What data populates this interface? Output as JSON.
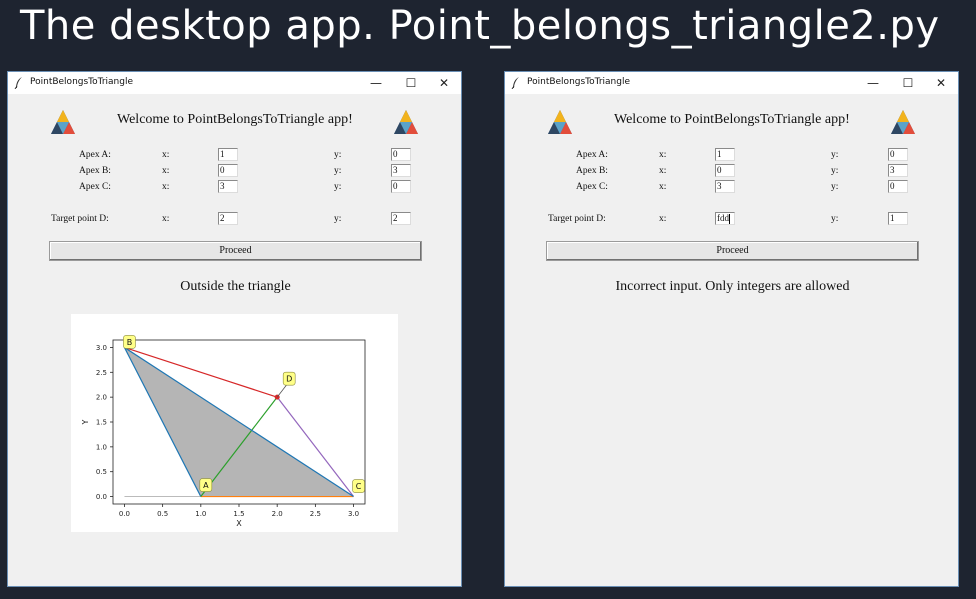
{
  "banner": "The desktop app. Point_belongs_triangle2.py",
  "windows": [
    {
      "title": "PointBelongsToTriangle",
      "controls": {
        "minimize": "—",
        "maximize": "☐",
        "close": "✕"
      },
      "welcome": "Welcome to PointBelongsToTriangle app!",
      "apexA": {
        "label": "Apex A:",
        "x_label": "x:",
        "x": "1",
        "y_label": "y:",
        "y": "0"
      },
      "apexB": {
        "label": "Apex B:",
        "x_label": "x:",
        "x": "0",
        "y_label": "y:",
        "y": "3"
      },
      "apexC": {
        "label": "Apex C:",
        "x_label": "x:",
        "x": "3",
        "y_label": "y:",
        "y": "0"
      },
      "target": {
        "label": "Target point D:",
        "x_label": "x:",
        "x": "2",
        "y_label": "y:",
        "y": "2"
      },
      "proceed": "Proceed",
      "result": "Outside the triangle"
    },
    {
      "title": "PointBelongsToTriangle",
      "controls": {
        "minimize": "—",
        "maximize": "☐",
        "close": "✕"
      },
      "welcome": "Welcome to PointBelongsToTriangle app!",
      "apexA": {
        "label": "Apex A:",
        "x_label": "x:",
        "x": "1",
        "y_label": "y:",
        "y": "0"
      },
      "apexB": {
        "label": "Apex B:",
        "x_label": "x:",
        "x": "0",
        "y_label": "y:",
        "y": "3"
      },
      "apexC": {
        "label": "Apex C:",
        "x_label": "x:",
        "x": "3",
        "y_label": "y:",
        "y": "0"
      },
      "target": {
        "label": "Target point D:",
        "x_label": "x:",
        "x": "fdd",
        "y_label": "y:",
        "y": "1"
      },
      "proceed": "Proceed",
      "result": "Incorrect input. Only integers are allowed"
    }
  ],
  "chart_data": {
    "type": "scatter",
    "xlabel": "X",
    "ylabel": "Y",
    "xlim": [
      -0.15,
      3.15
    ],
    "ylim": [
      -0.15,
      3.15
    ],
    "xticks": [
      "0.0",
      "0.5",
      "1.0",
      "1.5",
      "2.0",
      "2.5",
      "3.0"
    ],
    "yticks": [
      "0.0",
      "0.5",
      "1.0",
      "1.5",
      "2.0",
      "2.5",
      "3.0"
    ],
    "points": [
      {
        "name": "A",
        "x": 1,
        "y": 0
      },
      {
        "name": "B",
        "x": 0,
        "y": 3
      },
      {
        "name": "C",
        "x": 3,
        "y": 0
      },
      {
        "name": "D",
        "x": 2,
        "y": 2
      }
    ],
    "segments": [
      {
        "from": "A",
        "to": "B",
        "color": "#1f77b4"
      },
      {
        "from": "A",
        "to": "C",
        "color": "#ff7f0e"
      },
      {
        "from": "A",
        "to": "D",
        "color": "#2ca02c"
      },
      {
        "from": "B",
        "to": "D",
        "color": "#d62728"
      },
      {
        "from": "C",
        "to": "D",
        "color": "#9467bd"
      },
      {
        "from": "B",
        "to": "C",
        "color": "#1f77b4"
      }
    ],
    "fill_color": "#b5b5b5",
    "label_box_color": "#ffff88",
    "marker_color": "#d62728"
  }
}
